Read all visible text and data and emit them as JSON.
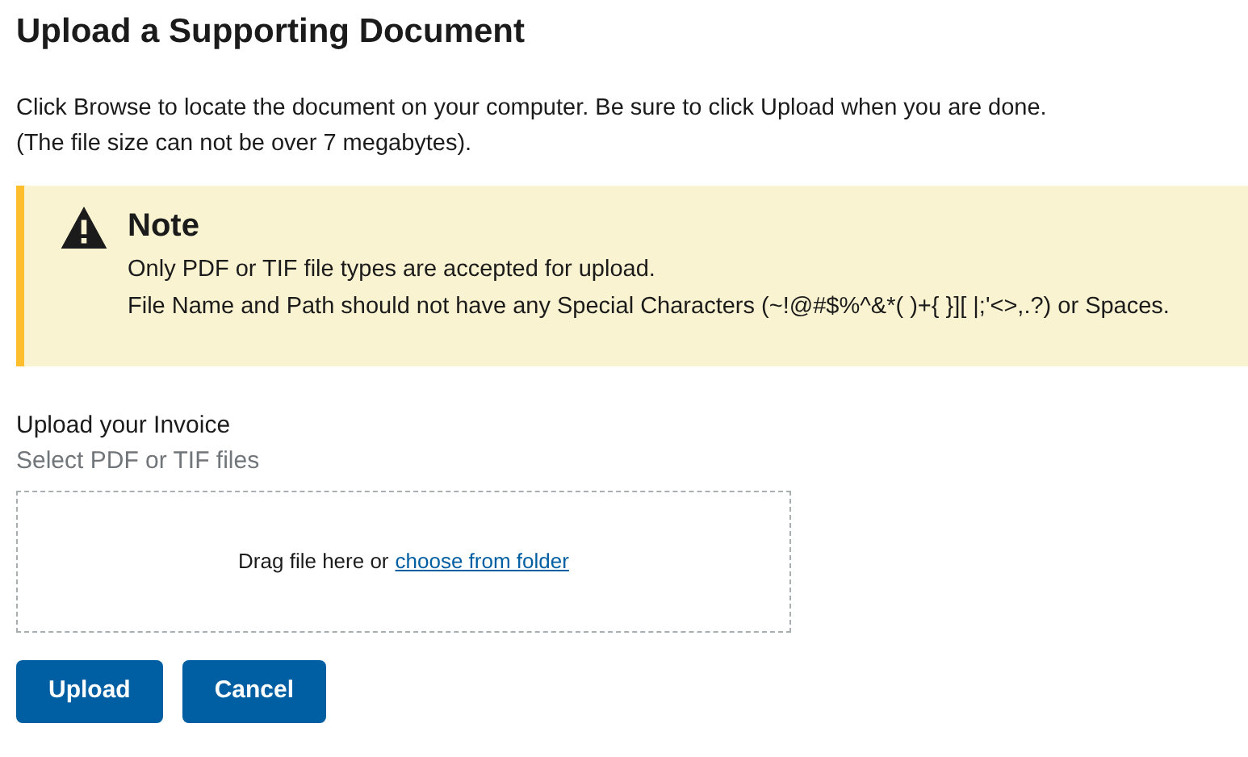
{
  "title": "Upload a Supporting Document",
  "intro": [
    "Click Browse to locate the document on your computer. Be sure to click Upload when you are done.",
    "(The file size can not be over 7 megabytes)."
  ],
  "note": {
    "title": "Note",
    "lines": [
      "Only PDF or TIF file types are accepted for upload.",
      "File Name and Path should not have any Special Characters (~!@#$%^&*( )+{ }][ |;'<>,.?) or Spaces."
    ]
  },
  "upload": {
    "label": "Upload your Invoice",
    "hint": "Select PDF or TIF files",
    "drop_text": "Drag file here or",
    "link": "choose from folder"
  },
  "buttons": [
    "Upload",
    "Cancel"
  ]
}
